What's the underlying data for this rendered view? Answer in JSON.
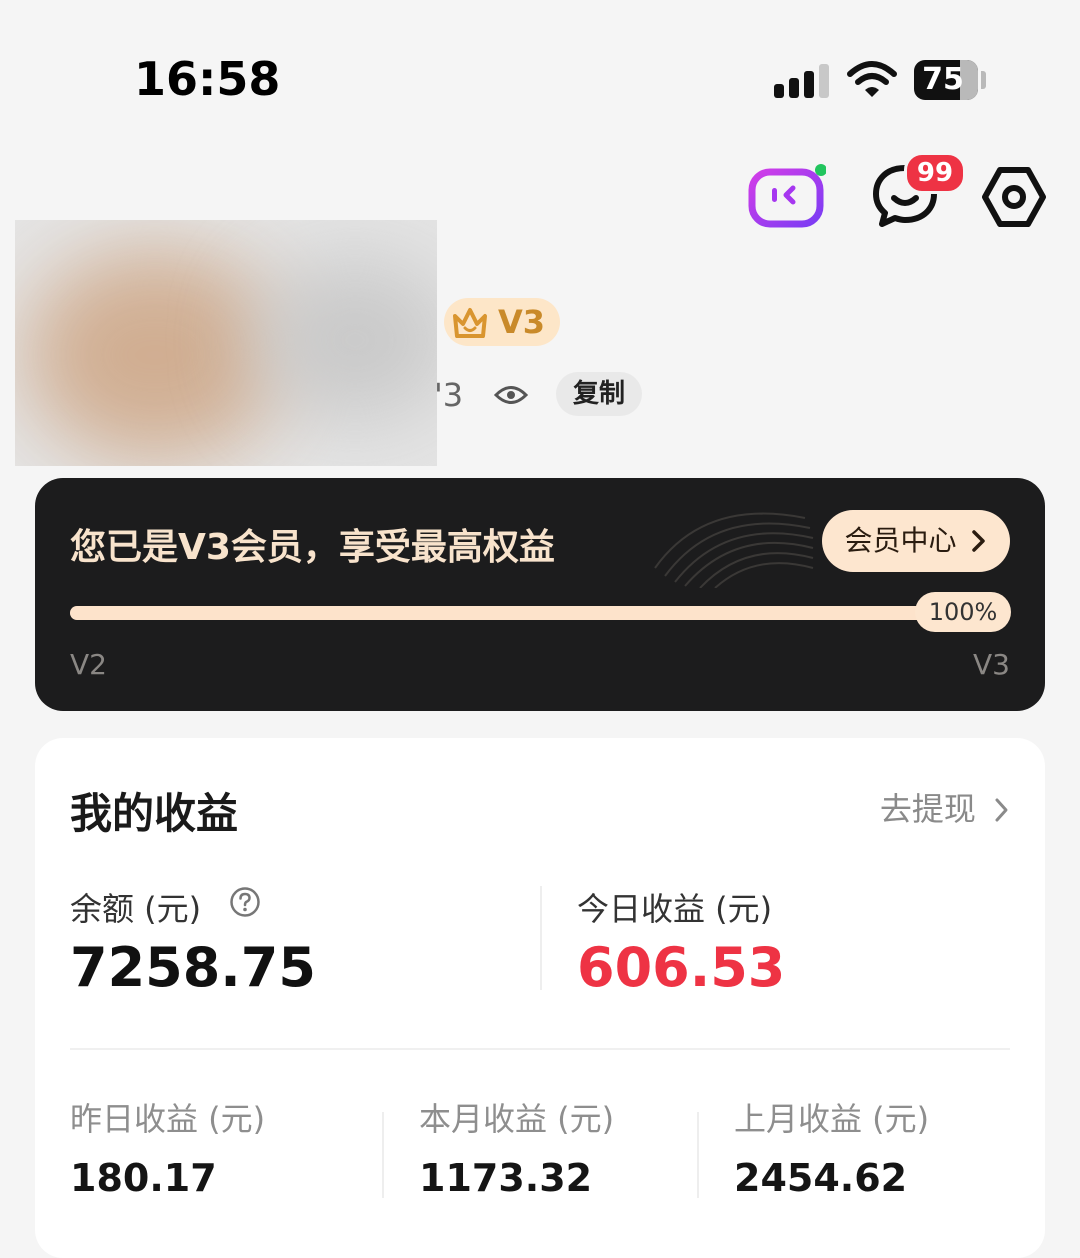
{
  "status_bar": {
    "time": "16:58",
    "battery": "75"
  },
  "top_icons": {
    "message_badge": "99"
  },
  "profile": {
    "vip_level": "V3",
    "id_tail": "'3",
    "copy_label": "复制"
  },
  "member_card": {
    "title": "您已是V3会员，享受最高权益",
    "center_button": "会员中心",
    "progress_fraction": 1.0,
    "progress_label": "100%",
    "level_from": "V2",
    "level_to": "V3"
  },
  "earnings": {
    "title": "我的收益",
    "withdraw_link": "去提现",
    "balance_label": "余额 (元)",
    "balance_value": "7258.75",
    "today_label": "今日收益 (元)",
    "today_value": "606.53",
    "yesterday_label": "昨日收益 (元)",
    "yesterday_value": "180.17",
    "month_label": "本月收益 (元)",
    "month_value": "1173.32",
    "last_month_label": "上月收益 (元)",
    "last_month_value": "2454.62"
  },
  "colors": {
    "highlight_red": "#ee3344",
    "card_dark": "#1c1c1d",
    "gold_light": "#fde6cf",
    "vip_gold": "#c98a2a",
    "tv_purple": "#a637f0"
  },
  "icons": [
    "signal-icon",
    "wifi-icon",
    "battery-icon",
    "tv-icon",
    "message-icon",
    "settings-icon",
    "crown-icon",
    "eye-icon",
    "chevron-right-icon",
    "help-icon"
  ]
}
